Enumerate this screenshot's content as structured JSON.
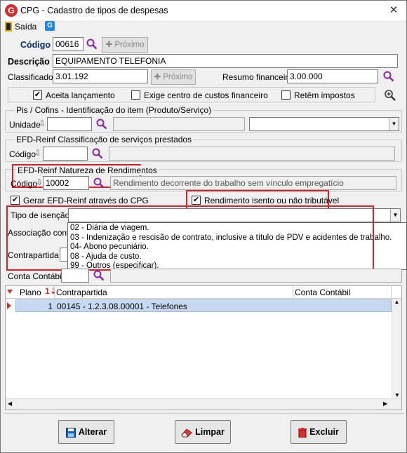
{
  "window": {
    "title": "CPG - Cadastro de tipos de despesas",
    "close_glyph": "✕"
  },
  "toolbar": {
    "exit_label": "Saída",
    "g_label": "G"
  },
  "codigo": {
    "label": "Código",
    "value": "00616",
    "next_label": "Próximo"
  },
  "descricao": {
    "label": "Descrição",
    "value": "EQUIPAMENTO TELEFONIA"
  },
  "classificador": {
    "label": "Classificador",
    "value": "3.01.192",
    "next_label": "Próximo"
  },
  "resumo": {
    "label": "Resumo financeiro",
    "value": "3.00.000"
  },
  "checks": {
    "aceita": {
      "label": "Aceita lançamento",
      "checked": true
    },
    "exige": {
      "label": "Exige centro de custos financeiro",
      "checked": false
    },
    "retem": {
      "label": "Retêm impostos",
      "checked": false
    }
  },
  "pis_cofins": {
    "title": "Pis / Cofins - Identificação do item (Produto/Serviço)",
    "unidade_label": "Unidade"
  },
  "efd_servicos": {
    "title": "EFD-Reinf Classificação de serviços prestados",
    "codigo_label": "Código"
  },
  "efd_natureza": {
    "title": "EFD-Reinf Natureza de Rendimentos",
    "codigo_label": "Código",
    "codigo_value": "10002",
    "description": "Rendimento decorrente do trabalho sem vínculo empregatício"
  },
  "gerar_efd": {
    "label": "Gerar EFD-Reinf através do CPG",
    "checked": true
  },
  "rendimento_isento": {
    "label": "Rendimento isento ou não tributável",
    "checked": true
  },
  "tipo_isencao": {
    "label": "Tipo de isenção",
    "value": "",
    "options": [
      "02 - Diária de viagem.",
      "03 - Indenização e rescisão de contrato, inclusive a título de PDV e acidentes de trabalho.",
      "04- Abono pecuniário.",
      "08 - Ajuda de custo.",
      "99 - Outros (especificar)."
    ]
  },
  "associacao_label": "Associação conta",
  "contrapartida_label": "Contrapartida",
  "conta_contabil_label": "Conta Contábil",
  "grid": {
    "headers": {
      "plano": "Plano",
      "contrapartida": "Contrapartida",
      "conta_contabil": "Conta Contábil"
    },
    "rows": [
      {
        "plano": "1",
        "contrapartida": "00145 - 1.2.3.08.00001 - Telefones",
        "conta_contabil": ""
      }
    ]
  },
  "buttons": {
    "alterar": "Alterar",
    "limpar": "Limpar",
    "excluir": "Excluir"
  },
  "colors": {
    "highlight_box": "#e02020",
    "row_selected": "#c7d9f1",
    "accent_blue": "#1e88e5"
  },
  "icons": [
    "app-logo-icon",
    "exit-door-icon",
    "g-logo-icon",
    "search-icon",
    "plus-icon",
    "zoom-plus-icon",
    "download-arrow-icon",
    "save-disk-icon",
    "eraser-icon",
    "trash-icon",
    "sort-icon"
  ]
}
